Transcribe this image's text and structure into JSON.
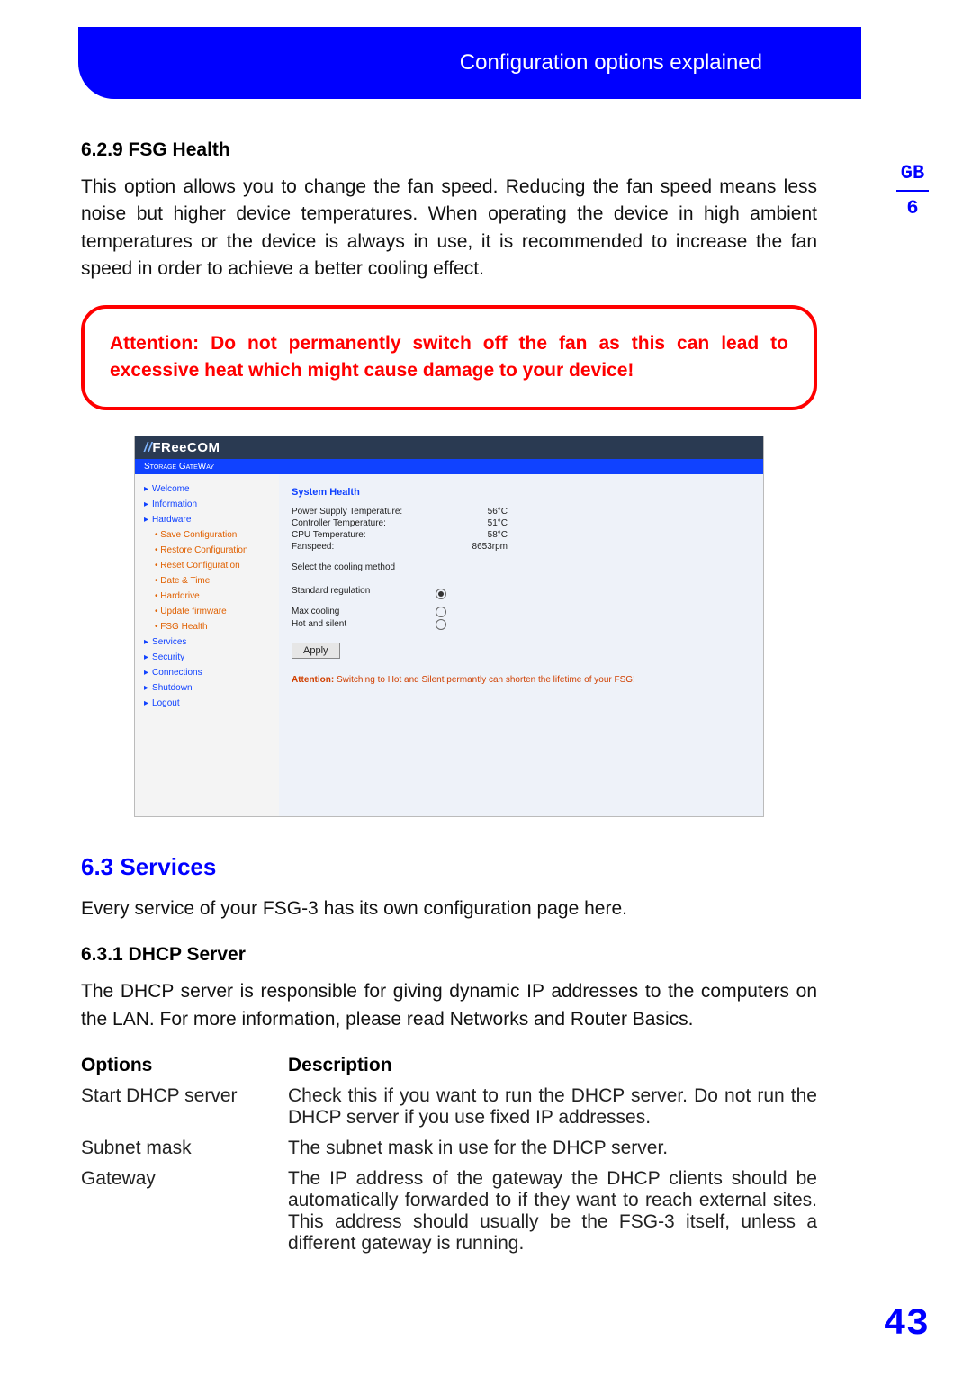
{
  "header": {
    "title": "Configuration options explained"
  },
  "thumb": {
    "lang": "GB",
    "chapter": "6"
  },
  "pagenum": "43",
  "s1": {
    "heading": "6.2.9 FSG Health",
    "text": "This option allows you to change the fan speed. Reducing the fan speed means less noise but higher device temperatures. When operating the device in high ambient temperatures or the device is always in use, it is recommended to increase the fan speed in order to achieve a better cooling effect."
  },
  "warning": "Attention: Do not permanently switch off the fan as this can lead to excessive heat which might cause damage to your device!",
  "shot": {
    "brand_pre": "//",
    "brand": "FReeCOM",
    "sub": "Storage GateWay",
    "nav": [
      "Welcome",
      "Information",
      "Hardware",
      "Save Configuration",
      "Restore Configuration",
      "Reset Configuration",
      "Date & Time",
      "Harddrive",
      "Update firmware",
      "FSG Health",
      "Services",
      "Security",
      "Connections",
      "Shutdown",
      "Logout"
    ],
    "panel_title": "System Health",
    "rows": [
      {
        "k": "Power Supply Temperature:",
        "v": "56°C"
      },
      {
        "k": "Controller Temperature:",
        "v": "51°C"
      },
      {
        "k": "CPU Temperature:",
        "v": "58°C"
      },
      {
        "k": "Fanspeed:",
        "v": "8653rpm"
      }
    ],
    "select_label": "Select the cooling method",
    "radios": [
      {
        "label": "Standard regulation",
        "selected": true
      },
      {
        "label": "Max cooling",
        "selected": false
      },
      {
        "label": "Hot and silent",
        "selected": false
      }
    ],
    "apply": "Apply",
    "warn_prefix": "Attention:",
    "warn_text": " Switching to Hot and Silent permantly can shorten the lifetime of your FSG!"
  },
  "s2": {
    "heading": "6.3 Services",
    "text": "Every service of your FSG-3 has its own configuration page here."
  },
  "s3": {
    "heading": "6.3.1 DHCP Server",
    "text": "The DHCP server is responsible for giving dynamic IP addresses to the computers on the LAN. For more information, please read Networks and Router Basics."
  },
  "table": {
    "h_o": "Options",
    "h_d": "Description",
    "rows": [
      {
        "o": "Start DHCP server",
        "d": "Check this if you want to run the DHCP server. Do not run the DHCP server if you use fixed IP addresses."
      },
      {
        "o": "Subnet mask",
        "d": "The subnet mask in use for the DHCP server."
      },
      {
        "o": "Gateway",
        "d": "The IP address of the gateway the DHCP clients should be automatically forwarded to if they want to reach external sites. This address should usually be the FSG-3 itself, unless a different gateway is running."
      }
    ]
  }
}
